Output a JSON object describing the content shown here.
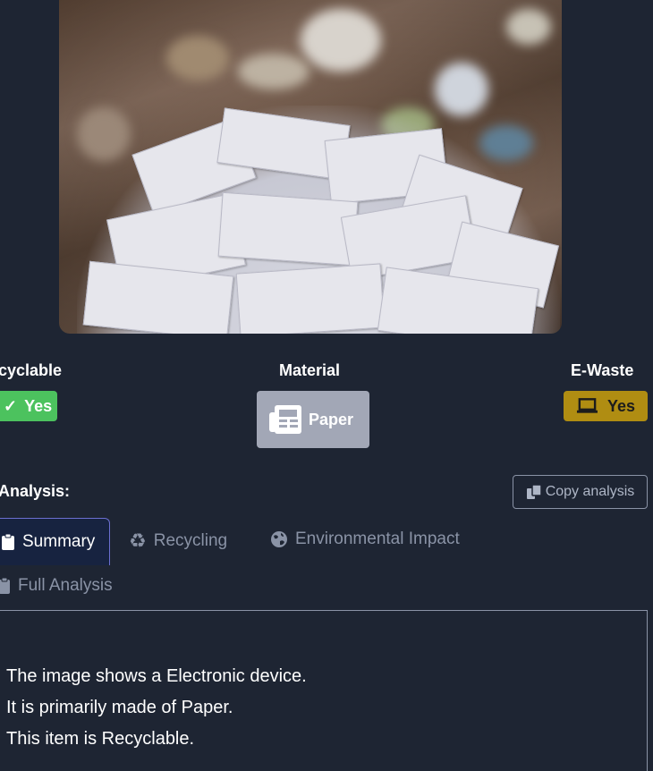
{
  "theme": {
    "background": "#1e2533",
    "recyclable_color": "#4cc25e",
    "material_color": "#a2a7b6",
    "ewaste_color": "#b08d12",
    "tab_accent": "#6b6fd0"
  },
  "image": {
    "subject": "pile of waste paper in front of mixed garbage"
  },
  "attributes": {
    "recyclable": {
      "label": "cyclable",
      "value": "Yes",
      "icon": "check-icon"
    },
    "material": {
      "label": "Material",
      "value": "Paper",
      "icon": "newspaper-icon"
    },
    "ewaste": {
      "label": "E-Waste",
      "value": "Yes",
      "icon": "laptop-icon"
    }
  },
  "analysis": {
    "title": "Analysis:",
    "copy_label": "Copy analysis",
    "tabs": [
      {
        "label": "Summary",
        "icon": "clipboard-icon",
        "active": true
      },
      {
        "label": "Recycling",
        "icon": "recycle-icon",
        "active": false
      },
      {
        "label": "Environmental Impact",
        "icon": "globe-icon",
        "active": false
      },
      {
        "label": "Full Analysis",
        "icon": "clipboard-icon",
        "active": false
      }
    ],
    "summary_lines": [
      "The image shows a Electronic device.",
      "It is primarily made of Paper.",
      "This item is Recyclable."
    ]
  }
}
